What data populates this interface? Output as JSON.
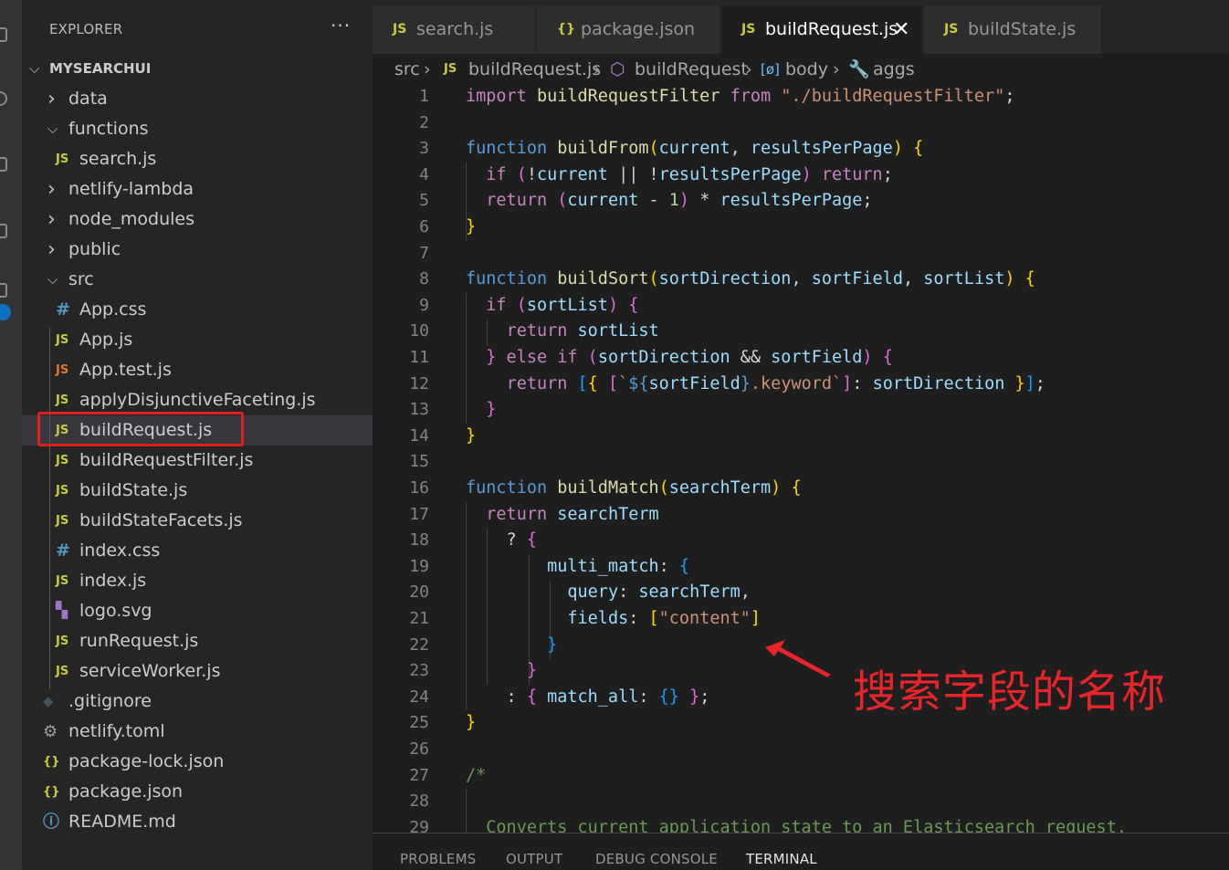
{
  "sidebar": {
    "title": "EXPLORER",
    "more": "···",
    "tree": [
      {
        "label": "MYSEARCHUI",
        "chev": "v",
        "icon": "",
        "indent": 0,
        "root": true
      },
      {
        "label": "data",
        "chev": ">",
        "icon": "",
        "indent": 1
      },
      {
        "label": "functions",
        "chev": "v",
        "icon": "",
        "indent": 1
      },
      {
        "label": "search.js",
        "chev": "",
        "icon": "JS",
        "indent": 2
      },
      {
        "label": "netlify-lambda",
        "chev": ">",
        "icon": "",
        "indent": 1
      },
      {
        "label": "node_modules",
        "chev": ">",
        "icon": "",
        "indent": 1
      },
      {
        "label": "public",
        "chev": ">",
        "icon": "",
        "indent": 1
      },
      {
        "label": "src",
        "chev": "v",
        "icon": "",
        "indent": 1
      },
      {
        "label": "App.css",
        "chev": "",
        "icon": "#",
        "indent": 2
      },
      {
        "label": "App.js",
        "chev": "",
        "icon": "JS",
        "indent": 2
      },
      {
        "label": "App.test.js",
        "chev": "",
        "icon": "JS",
        "indent": 2,
        "iconColor": "#e37933"
      },
      {
        "label": "applyDisjunctiveFaceting.js",
        "chev": "",
        "icon": "JS",
        "indent": 2
      },
      {
        "label": "buildRequest.js",
        "chev": "",
        "icon": "JS",
        "indent": 2,
        "selected": true
      },
      {
        "label": "buildRequestFilter.js",
        "chev": "",
        "icon": "JS",
        "indent": 2
      },
      {
        "label": "buildState.js",
        "chev": "",
        "icon": "JS",
        "indent": 2
      },
      {
        "label": "buildStateFacets.js",
        "chev": "",
        "icon": "JS",
        "indent": 2
      },
      {
        "label": "index.css",
        "chev": "",
        "icon": "#",
        "indent": 2
      },
      {
        "label": "index.js",
        "chev": "",
        "icon": "JS",
        "indent": 2
      },
      {
        "label": "logo.svg",
        "chev": "",
        "icon": "svg",
        "indent": 2
      },
      {
        "label": "runRequest.js",
        "chev": "",
        "icon": "JS",
        "indent": 2
      },
      {
        "label": "serviceWorker.js",
        "chev": "",
        "icon": "JS",
        "indent": 2
      },
      {
        "label": ".gitignore",
        "chev": "",
        "icon": "git",
        "indent": 1
      },
      {
        "label": "netlify.toml",
        "chev": "",
        "icon": "gear",
        "indent": 1
      },
      {
        "label": "package-lock.json",
        "chev": "",
        "icon": "{}",
        "indent": 1
      },
      {
        "label": "package.json",
        "chev": "",
        "icon": "{}",
        "indent": 1
      },
      {
        "label": "README.md",
        "chev": "",
        "icon": "info",
        "indent": 1
      }
    ]
  },
  "tabs": [
    {
      "label": "search.js",
      "icon": "JS",
      "active": false
    },
    {
      "label": "package.json",
      "icon": "{}",
      "active": false
    },
    {
      "label": "buildRequest.js",
      "icon": "JS",
      "active": true,
      "close": "✕"
    },
    {
      "label": "buildState.js",
      "icon": "JS",
      "active": false
    }
  ],
  "breadcrumb": {
    "src": "src",
    "file": "buildRequest.js",
    "fn": "buildRequest",
    "var": "body",
    "prop": "aggs"
  },
  "code": {
    "line_numbers": [
      "1",
      "2",
      "3",
      "4",
      "5",
      "6",
      "7",
      "8",
      "9",
      "10",
      "11",
      "12",
      "13",
      "14",
      "15",
      "16",
      "17",
      "18",
      "19",
      "20",
      "21",
      "22",
      "23",
      "24",
      "25",
      "26",
      "27",
      "28",
      "29"
    ],
    "lines": [
      [
        [
          "ct",
          "import "
        ],
        [
          "fn",
          "buildRequestFilter"
        ],
        [
          "ct",
          " from "
        ],
        [
          "st",
          "\"./buildRequestFilter\""
        ],
        [
          "op",
          ";"
        ]
      ],
      [],
      [
        [
          "kw",
          "function "
        ],
        [
          "fn",
          "buildFrom"
        ],
        [
          "p1",
          "("
        ],
        [
          "vr",
          "current"
        ],
        [
          "op",
          ", "
        ],
        [
          "vr",
          "resultsPerPage"
        ],
        [
          "p1",
          ")"
        ],
        [
          "op",
          " "
        ],
        [
          "p1",
          "{"
        ]
      ],
      [
        [
          "op",
          "  "
        ],
        [
          "ct",
          "if "
        ],
        [
          "p2",
          "("
        ],
        [
          "op",
          "!"
        ],
        [
          "vr",
          "current"
        ],
        [
          "op",
          " || !"
        ],
        [
          "vr",
          "resultsPerPage"
        ],
        [
          "p2",
          ")"
        ],
        [
          "ct",
          " return"
        ],
        [
          "op",
          ";"
        ]
      ],
      [
        [
          "op",
          "  "
        ],
        [
          "ct",
          "return "
        ],
        [
          "p2",
          "("
        ],
        [
          "vr",
          "current"
        ],
        [
          "op",
          " - "
        ],
        [
          "nm",
          "1"
        ],
        [
          "p2",
          ")"
        ],
        [
          "op",
          " * "
        ],
        [
          "vr",
          "resultsPerPage"
        ],
        [
          "op",
          ";"
        ]
      ],
      [
        [
          "p1",
          "}"
        ]
      ],
      [],
      [
        [
          "kw",
          "function "
        ],
        [
          "fn",
          "buildSort"
        ],
        [
          "p1",
          "("
        ],
        [
          "vr",
          "sortDirection"
        ],
        [
          "op",
          ", "
        ],
        [
          "vr",
          "sortField"
        ],
        [
          "op",
          ", "
        ],
        [
          "vr",
          "sortList"
        ],
        [
          "p1",
          ")"
        ],
        [
          "op",
          " "
        ],
        [
          "p1",
          "{"
        ]
      ],
      [
        [
          "op",
          "  "
        ],
        [
          "ct",
          "if "
        ],
        [
          "p2",
          "("
        ],
        [
          "vr",
          "sortList"
        ],
        [
          "p2",
          ")"
        ],
        [
          "op",
          " "
        ],
        [
          "p2",
          "{"
        ]
      ],
      [
        [
          "op",
          "    "
        ],
        [
          "ct",
          "return "
        ],
        [
          "vr",
          "sortList"
        ]
      ],
      [
        [
          "op",
          "  "
        ],
        [
          "p2",
          "}"
        ],
        [
          "ct",
          " else if "
        ],
        [
          "p2",
          "("
        ],
        [
          "vr",
          "sortDirection"
        ],
        [
          "op",
          " && "
        ],
        [
          "vr",
          "sortField"
        ],
        [
          "p2",
          ")"
        ],
        [
          "op",
          " "
        ],
        [
          "p2",
          "{"
        ]
      ],
      [
        [
          "op",
          "    "
        ],
        [
          "ct",
          "return "
        ],
        [
          "p3",
          "["
        ],
        [
          "p1",
          "{"
        ],
        [
          "op",
          " "
        ],
        [
          "p2",
          "["
        ],
        [
          "st",
          "`"
        ],
        [
          "kw",
          "${"
        ],
        [
          "vr",
          "sortField"
        ],
        [
          "kw",
          "}"
        ],
        [
          "st",
          ".keyword`"
        ],
        [
          "p2",
          "]"
        ],
        [
          "op",
          ": "
        ],
        [
          "vr",
          "sortDirection"
        ],
        [
          "op",
          " "
        ],
        [
          "p1",
          "}"
        ],
        [
          "p3",
          "]"
        ],
        [
          "op",
          ";"
        ]
      ],
      [
        [
          "op",
          "  "
        ],
        [
          "p2",
          "}"
        ]
      ],
      [
        [
          "p1",
          "}"
        ]
      ],
      [],
      [
        [
          "kw",
          "function "
        ],
        [
          "fn",
          "buildMatch"
        ],
        [
          "p1",
          "("
        ],
        [
          "vr",
          "searchTerm"
        ],
        [
          "p1",
          ")"
        ],
        [
          "op",
          " "
        ],
        [
          "p1",
          "{"
        ]
      ],
      [
        [
          "op",
          "  "
        ],
        [
          "ct",
          "return "
        ],
        [
          "vr",
          "searchTerm"
        ]
      ],
      [
        [
          "op",
          "    ? "
        ],
        [
          "p2",
          "{"
        ]
      ],
      [
        [
          "op",
          "        "
        ],
        [
          "vr",
          "multi_match"
        ],
        [
          "op",
          ": "
        ],
        [
          "p3",
          "{"
        ]
      ],
      [
        [
          "op",
          "          "
        ],
        [
          "vr",
          "query"
        ],
        [
          "op",
          ": "
        ],
        [
          "vr",
          "searchTerm"
        ],
        [
          "op",
          ","
        ]
      ],
      [
        [
          "op",
          "          "
        ],
        [
          "vr",
          "fields"
        ],
        [
          "op",
          ": "
        ],
        [
          "p1",
          "["
        ],
        [
          "st",
          "\"content\""
        ],
        [
          "p1",
          "]"
        ]
      ],
      [
        [
          "op",
          "        "
        ],
        [
          "p3",
          "}"
        ]
      ],
      [
        [
          "op",
          "      "
        ],
        [
          "p2",
          "}"
        ]
      ],
      [
        [
          "op",
          "    : "
        ],
        [
          "p2",
          "{"
        ],
        [
          "op",
          " "
        ],
        [
          "vr",
          "match_all"
        ],
        [
          "op",
          ": "
        ],
        [
          "p3",
          "{}"
        ],
        [
          "op",
          " "
        ],
        [
          "p2",
          "}"
        ],
        [
          "op",
          ";"
        ]
      ],
      [
        [
          "p1",
          "}"
        ]
      ],
      [],
      [
        [
          "cm",
          "/*"
        ]
      ],
      [],
      [
        [
          "cm",
          "  Converts current application state to an Elasticsearch request."
        ]
      ]
    ]
  },
  "panel": {
    "tabs": [
      "PROBLEMS",
      "OUTPUT",
      "DEBUG CONSOLE",
      "TERMINAL"
    ],
    "active": "TERMINAL"
  },
  "annotation": {
    "text": "搜索字段的名称",
    "color": "#e8262a"
  }
}
